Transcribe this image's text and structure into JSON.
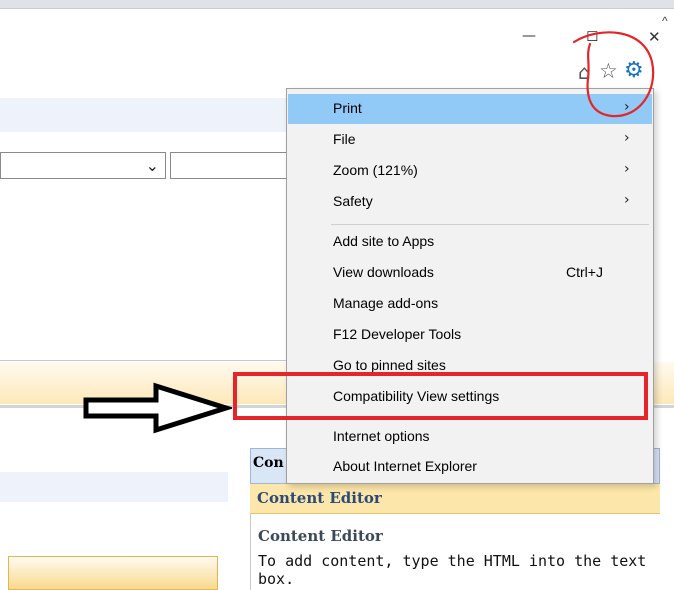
{
  "window": {
    "minimize_icon": "minimize-icon",
    "restore_icon": "restore-icon",
    "close_icon": "close-icon",
    "minimize_glyph": "—",
    "restore_glyph": "◻",
    "close_glyph": "✕",
    "scroll_up_glyph": "^"
  },
  "toolbar": {
    "home_glyph": "⌂",
    "favorites_glyph": "☆",
    "tools_glyph": "⚙"
  },
  "page": {
    "dropdown_chevron": "⌄",
    "web_part_header": "Con",
    "web_part_title": "Content Editor",
    "web_part_body_title": "Content Editor",
    "web_part_body_text": "To add content, type the HTML into the text box."
  },
  "menu": {
    "items": [
      {
        "label": "Print",
        "submenu": true,
        "highlighted": true
      },
      {
        "label": "File",
        "submenu": true
      },
      {
        "label": "Zoom (121%)",
        "submenu": true
      },
      {
        "label": "Safety",
        "submenu": true
      },
      {
        "label": "Add site to Apps"
      },
      {
        "label": "View downloads",
        "shortcut": "Ctrl+J"
      },
      {
        "label": "Manage add-ons"
      },
      {
        "label": "F12 Developer Tools"
      },
      {
        "label": "Go to pinned sites"
      },
      {
        "label": "Compatibility View settings"
      },
      {
        "label": "Internet options"
      },
      {
        "label": "About Internet Explorer"
      }
    ],
    "submenu_arrow": "›"
  },
  "colors": {
    "menu_highlight": "#91c9f7",
    "annotation_red": "#e5252a",
    "accent_blue": "#1e73be"
  }
}
